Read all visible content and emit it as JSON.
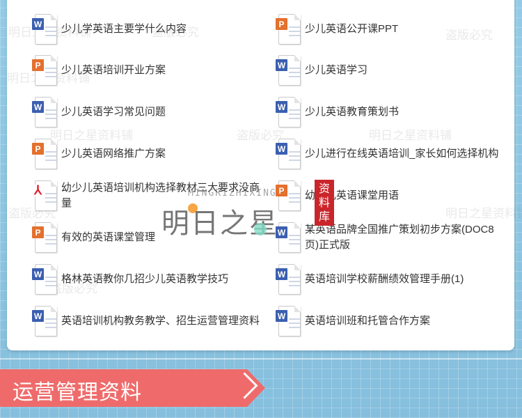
{
  "watermarks": [
    "明日之星资料铺",
    "盗版必究",
    "明日之星资料铺",
    "盗版必究",
    "明日之星资料铺",
    "盗版必究",
    "明日之星资料铺",
    "盗版必究",
    "明日之星资料铺",
    "盗版必究"
  ],
  "brand": {
    "latin": "MINGRIZHIXING",
    "chinese": "明日之星"
  },
  "seal": {
    "text": "资料库"
  },
  "documents": {
    "left": [
      {
        "type": "word",
        "icon": "word-doc-icon",
        "title": "少儿学英语主要学什么内容"
      },
      {
        "type": "ppt",
        "icon": "ppt-doc-icon",
        "title": "少儿英语培训开业方案"
      },
      {
        "type": "word",
        "icon": "word-doc-icon",
        "title": "少儿英语学习常见问题"
      },
      {
        "type": "ppt",
        "icon": "ppt-doc-icon",
        "title": "少儿英语网络推广方案"
      },
      {
        "type": "pdf",
        "icon": "pdf-doc-icon",
        "title": "幼少儿英语培训机构选择教材三大要求没商量"
      },
      {
        "type": "ppt",
        "icon": "ppt-doc-icon",
        "title": "有效的英语课堂管理"
      },
      {
        "type": "word",
        "icon": "word-doc-icon",
        "title": "格林英语教你几招少儿英语教学技巧"
      },
      {
        "type": "word",
        "icon": "word-doc-icon",
        "title": "英语培训机构教务教学、招生运营管理资料"
      }
    ],
    "right": [
      {
        "type": "ppt",
        "icon": "ppt-doc-icon",
        "title": "少儿英语公开课PPT"
      },
      {
        "type": "word",
        "icon": "word-doc-icon",
        "title": "少儿英语学习"
      },
      {
        "type": "word",
        "icon": "word-doc-icon",
        "title": "少儿英语教育策划书"
      },
      {
        "type": "word",
        "icon": "word-doc-icon",
        "title": "少儿进行在线英语培训_家长如何选择机构"
      },
      {
        "type": "ppt",
        "icon": "ppt-doc-icon",
        "title": "幼少儿英语课堂用语"
      },
      {
        "type": "word",
        "icon": "word-doc-icon",
        "title": "某英语品牌全国推广策划初步方案(DOC8页)正式版"
      },
      {
        "type": "word",
        "icon": "word-doc-icon",
        "title": "英语培训学校薪酬绩效管理手册(1)"
      },
      {
        "type": "word",
        "icon": "word-doc-icon",
        "title": "英语培训班和托管合作方案"
      }
    ]
  },
  "section_banner": {
    "title": "运营管理资料",
    "color": "#ef6b6b"
  },
  "colors": {
    "background": "#8fc6e2",
    "word_badge": "#3b5fb0",
    "ppt_badge": "#e4702d",
    "pdf_mark": "#e0232f"
  }
}
